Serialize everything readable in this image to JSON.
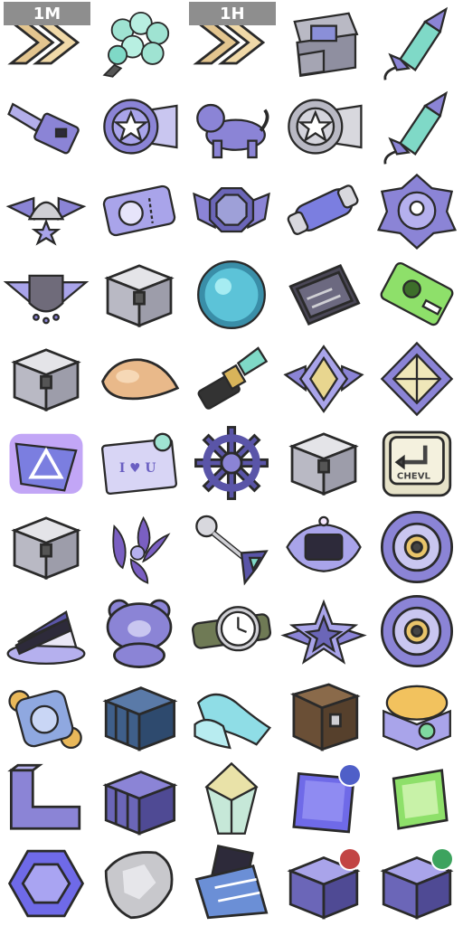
{
  "speed_tags": {
    "one_minute": "1M",
    "one_hour": "1H"
  },
  "postcard_text": "I ♥ U",
  "key_text": "CHEVL",
  "colors": {
    "purple": "#8b84d6",
    "dark": "#2d2a3a",
    "silver": "#cfcfd4",
    "teal": "#7fd9c7",
    "green": "#8ee06a",
    "gold": "#e9b85a",
    "tag_bg": "#8e8e8e"
  },
  "items": [
    "speedup-chevrons-1m",
    "teal-rose-bouquet",
    "speedup-chevrons-1h",
    "open-treasure-chest",
    "rocket-firework",
    "usb-key",
    "purple-star-medal",
    "tiger-statue",
    "silver-star-medal",
    "rocket-firework",
    "winged-helmet-badge",
    "ticket-voucher",
    "winged-octagon-badge",
    "energy-capsule",
    "floral-emblem",
    "winged-shield-badge",
    "silver-chest",
    "spiky-teal-orb",
    "tool-kit-case",
    "green-ticket",
    "silver-chest",
    "amber-teardrop",
    "teal-lipstick",
    "crystal-emblem",
    "diamond-emblem",
    "glowing-triangle-shard",
    "love-postcard",
    "ship-wheel",
    "silver-chest",
    "keyboard-key",
    "silver-chest",
    "purple-flower-bunch",
    "ornate-key",
    "glowing-mirror-frame",
    "vault-dial",
    "layer-cake-slice",
    "bear-jelly",
    "wristwatch",
    "winged-star-badge",
    "vault-dial",
    "gold-coin-bag",
    "striped-chest",
    "glass-slippers",
    "wooden-chest",
    "gold-nugget-box",
    "purple-lbar",
    "striped-chest",
    "rainbow-crystal",
    "purple-cube-gem",
    "green-cube-gem",
    "hexagon-gem",
    "silver-stone",
    "chocolate-bar",
    "rune-cube",
    "rune-cube"
  ],
  "badges": [
    {
      "cell": 48,
      "color": "#4f5fc8"
    },
    {
      "cell": 53,
      "color": "#c24444"
    },
    {
      "cell": 54,
      "color": "#3da35e"
    }
  ]
}
